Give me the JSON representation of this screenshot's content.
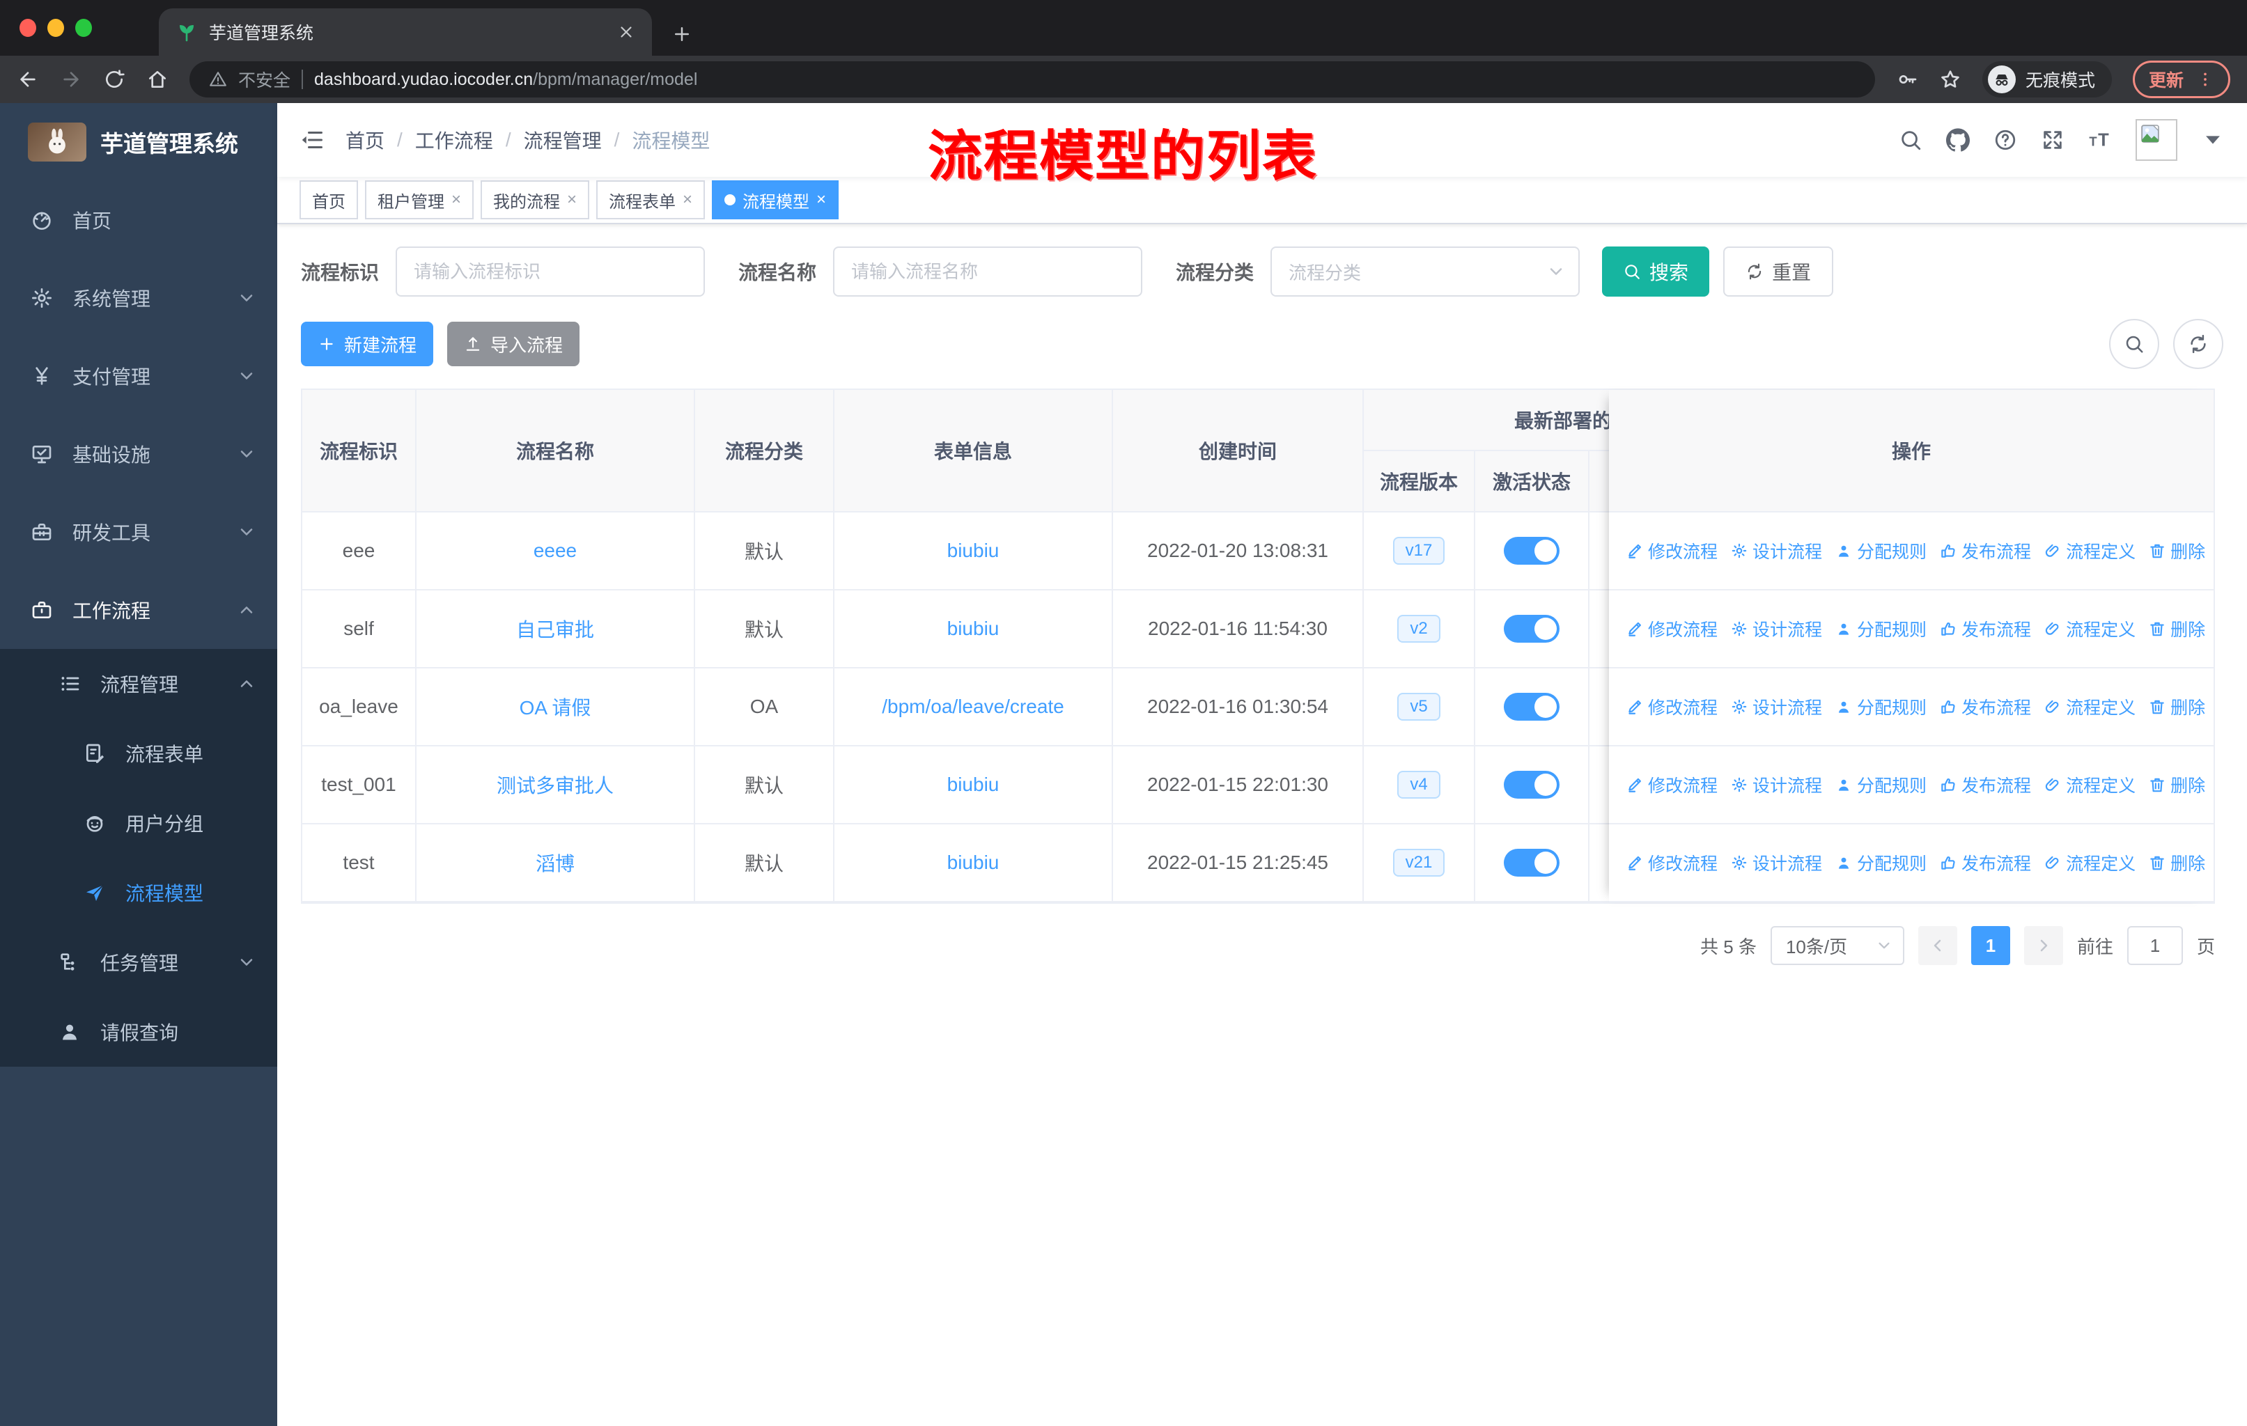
{
  "browser": {
    "tab_title": "芋道管理系统",
    "security_label": "不安全",
    "url_host": "dashboard.yudao.iocoder.cn",
    "url_path": "/bpm/manager/model",
    "incognito_label": "无痕模式",
    "update_label": "更新"
  },
  "sidebar": {
    "title": "芋道管理系统",
    "items": [
      {
        "label": "首页",
        "icon": "dashboard-icon",
        "level": 1,
        "chevron": null,
        "state": "normal"
      },
      {
        "label": "系统管理",
        "icon": "gear-icon",
        "level": 1,
        "chevron": "down",
        "state": "normal"
      },
      {
        "label": "支付管理",
        "icon": "yen-icon",
        "level": 1,
        "chevron": "down",
        "state": "normal"
      },
      {
        "label": "基础设施",
        "icon": "monitor-icon",
        "level": 1,
        "chevron": "down",
        "state": "normal"
      },
      {
        "label": "研发工具",
        "icon": "toolbox-icon",
        "level": 1,
        "chevron": "down",
        "state": "normal"
      },
      {
        "label": "工作流程",
        "icon": "briefcase-icon",
        "level": 1,
        "chevron": "up",
        "state": "parent-open"
      },
      {
        "label": "流程管理",
        "icon": "list-icon",
        "level": 2,
        "chevron": "up",
        "state": "submenu"
      },
      {
        "label": "流程表单",
        "icon": "form-icon",
        "level": 3,
        "chevron": null,
        "state": "submenu"
      },
      {
        "label": "用户分组",
        "icon": "users-icon",
        "level": 3,
        "chevron": null,
        "state": "submenu"
      },
      {
        "label": "流程模型",
        "icon": "send-icon",
        "level": 3,
        "chevron": null,
        "state": "submenu-active"
      },
      {
        "label": "任务管理",
        "icon": "tree-icon",
        "level": 2,
        "chevron": "down",
        "state": "submenu"
      },
      {
        "label": "请假查询",
        "icon": "person-icon",
        "level": 2,
        "chevron": null,
        "state": "submenu"
      }
    ]
  },
  "navbar": {
    "breadcrumb": [
      "首页",
      "工作流程",
      "流程管理",
      "流程模型"
    ],
    "annotation": "流程模型的列表"
  },
  "tags": [
    {
      "label": "首页",
      "closable": false,
      "active": false
    },
    {
      "label": "租户管理",
      "closable": true,
      "active": false
    },
    {
      "label": "我的流程",
      "closable": true,
      "active": false
    },
    {
      "label": "流程表单",
      "closable": true,
      "active": false
    },
    {
      "label": "流程模型",
      "closable": true,
      "active": true
    }
  ],
  "search": {
    "fields": [
      {
        "label": "流程标识",
        "placeholder": "请输入流程标识",
        "type": "input"
      },
      {
        "label": "流程名称",
        "placeholder": "请输入流程名称",
        "type": "input"
      },
      {
        "label": "流程分类",
        "placeholder": "流程分类",
        "type": "select"
      }
    ],
    "search_label": "搜索",
    "reset_label": "重置"
  },
  "toolbar": {
    "create_label": "新建流程",
    "import_label": "导入流程"
  },
  "table": {
    "columns": [
      "流程标识",
      "流程名称",
      "流程分类",
      "表单信息",
      "创建时间"
    ],
    "group_header": "最新部署的",
    "sub_columns": [
      "流程版本",
      "激活状态"
    ],
    "ops_header": "操作",
    "actions": [
      {
        "label": "修改流程",
        "icon": "pencil-icon"
      },
      {
        "label": "设计流程",
        "icon": "design-icon"
      },
      {
        "label": "分配规则",
        "icon": "assign-icon"
      },
      {
        "label": "发布流程",
        "icon": "publish-icon"
      },
      {
        "label": "流程定义",
        "icon": "definition-icon"
      },
      {
        "label": "删除",
        "icon": "delete-icon"
      }
    ],
    "rows": [
      {
        "key": "eee",
        "name": "eeee",
        "category": "默认",
        "form": "biubiu",
        "created": "2022-01-20 13:08:31",
        "version": "v17",
        "active": true
      },
      {
        "key": "self",
        "name": "自己审批",
        "category": "默认",
        "form": "biubiu",
        "created": "2022-01-16 11:54:30",
        "version": "v2",
        "active": true
      },
      {
        "key": "oa_leave",
        "name": "OA 请假",
        "category": "OA",
        "form": "/bpm/oa/leave/create",
        "created": "2022-01-16 01:30:54",
        "version": "v5",
        "active": true
      },
      {
        "key": "test_001",
        "name": "测试多审批人",
        "category": "默认",
        "form": "biubiu",
        "created": "2022-01-15 22:01:30",
        "version": "v4",
        "active": true
      },
      {
        "key": "test",
        "name": "滔博",
        "category": "默认",
        "form": "biubiu",
        "created": "2022-01-15 21:25:45",
        "version": "v21",
        "active": true
      }
    ]
  },
  "pagination": {
    "total": "共 5 条",
    "page_size": "10条/页",
    "current": "1",
    "goto_label": "前往",
    "goto_value": "1",
    "page_label": "页"
  },
  "colors": {
    "accent": "#409eff",
    "search_button": "#16b5a0",
    "sidebar_bg": "#304156",
    "submenu_bg": "#1f2d3d",
    "update_pill": "#f28b82"
  }
}
